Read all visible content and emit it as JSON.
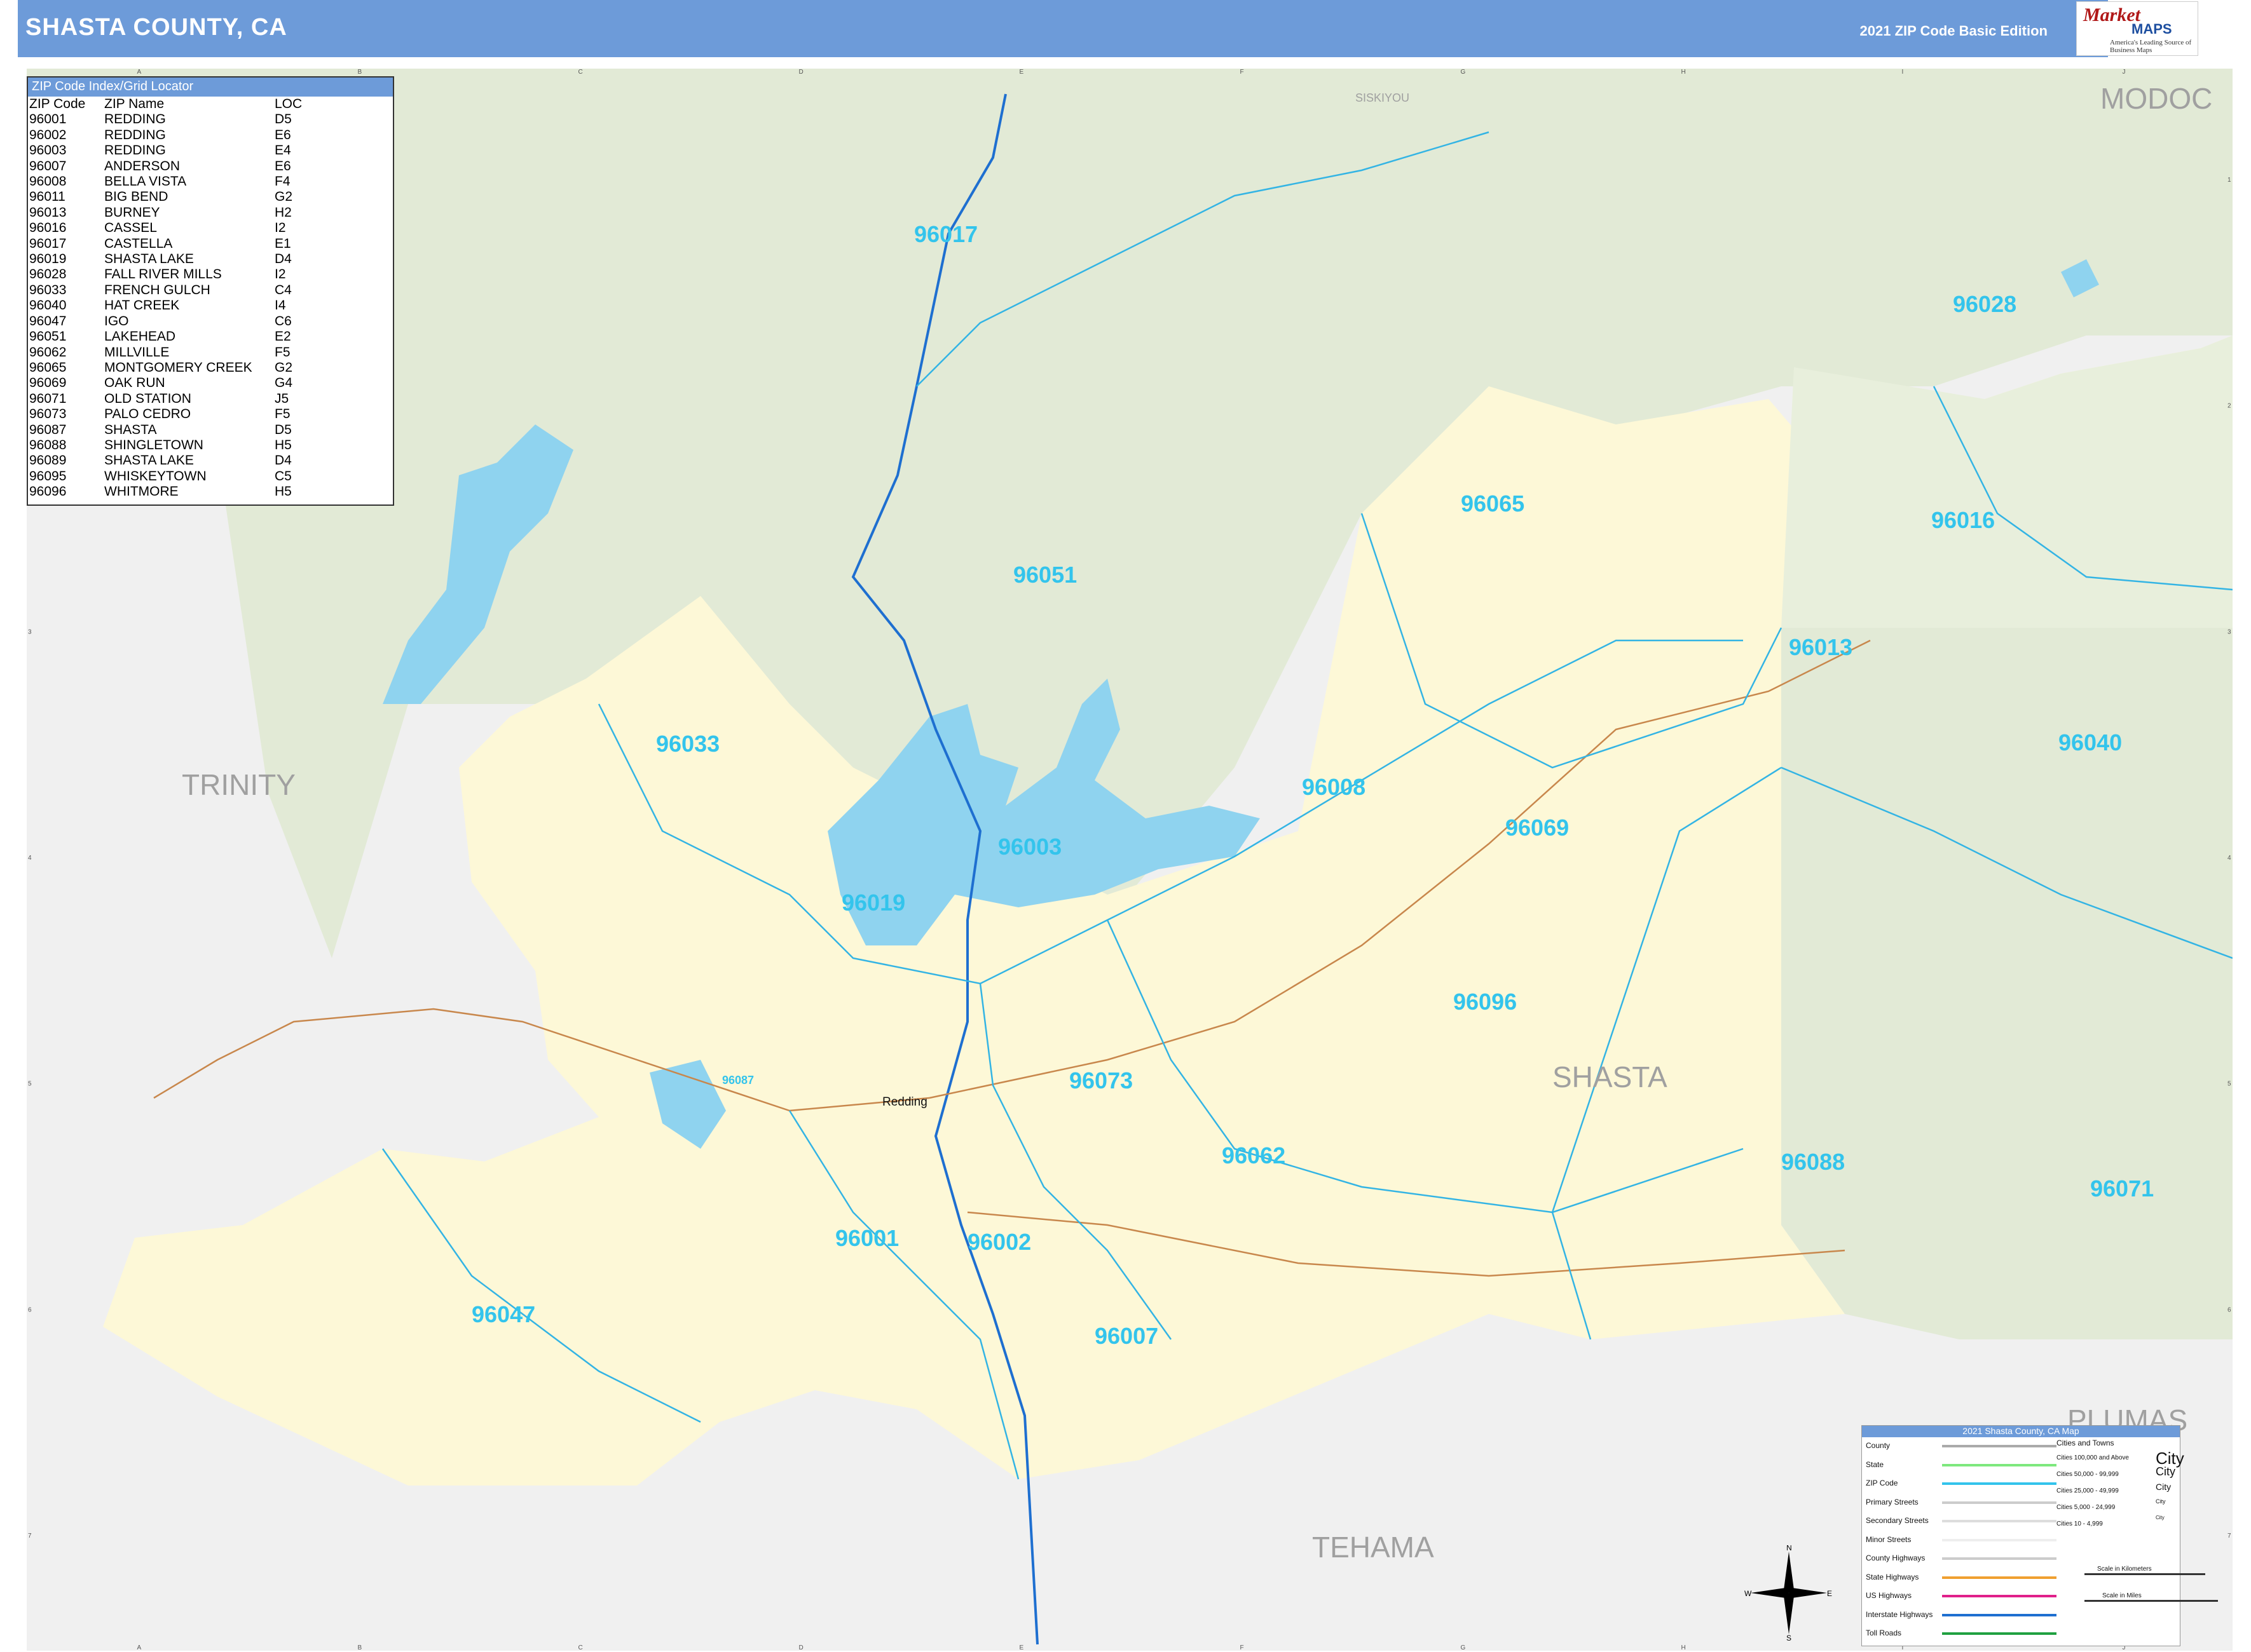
{
  "header": {
    "title": "SHASTA COUNTY, CA",
    "edition": "2021 ZIP Code Basic Edition",
    "logo": {
      "line1": "Market",
      "line2": "MAPS",
      "tagline": "America's Leading Source of Business Maps"
    }
  },
  "zip_index": {
    "title": "ZIP Code Index/Grid Locator",
    "columns": [
      "ZIP Code",
      "ZIP Name",
      "LOC"
    ],
    "rows": [
      [
        "96001",
        "REDDING",
        "D5"
      ],
      [
        "96002",
        "REDDING",
        "E6"
      ],
      [
        "96003",
        "REDDING",
        "E4"
      ],
      [
        "96007",
        "ANDERSON",
        "E6"
      ],
      [
        "96008",
        "BELLA VISTA",
        "F4"
      ],
      [
        "96011",
        "BIG BEND",
        "G2"
      ],
      [
        "96013",
        "BURNEY",
        "H2"
      ],
      [
        "96016",
        "CASSEL",
        "I2"
      ],
      [
        "96017",
        "CASTELLA",
        "E1"
      ],
      [
        "96019",
        "SHASTA LAKE",
        "D4"
      ],
      [
        "96028",
        "FALL RIVER MILLS",
        "I2"
      ],
      [
        "96033",
        "FRENCH GULCH",
        "C4"
      ],
      [
        "96040",
        "HAT CREEK",
        "I4"
      ],
      [
        "96047",
        "IGO",
        "C6"
      ],
      [
        "96051",
        "LAKEHEAD",
        "E2"
      ],
      [
        "96062",
        "MILLVILLE",
        "F5"
      ],
      [
        "96065",
        "MONTGOMERY CREEK",
        "G2"
      ],
      [
        "96069",
        "OAK RUN",
        "G4"
      ],
      [
        "96071",
        "OLD STATION",
        "J5"
      ],
      [
        "96073",
        "PALO CEDRO",
        "F5"
      ],
      [
        "96087",
        "SHASTA",
        "D5"
      ],
      [
        "96088",
        "SHINGLETOWN",
        "H5"
      ],
      [
        "96089",
        "SHASTA LAKE",
        "D4"
      ],
      [
        "96095",
        "WHISKEYTOWN",
        "C5"
      ],
      [
        "96096",
        "WHITMORE",
        "H5"
      ]
    ]
  },
  "map": {
    "counties": {
      "trinity": "TRINITY",
      "shasta": "SHASTA",
      "tehama": "TEHAMA",
      "modoc": "MODOC",
      "plumas": "PLUMAS",
      "siskiyou": "SISKIYOU"
    },
    "zips": {
      "z96017": "96017",
      "z96028": "96028",
      "z96065": "96065",
      "z96016": "96016",
      "z96051": "96051",
      "z96013": "96013",
      "z96033": "96033",
      "z96008": "96008",
      "z96069": "96069",
      "z96040": "96040",
      "z96003": "96003",
      "z96019": "96019",
      "z96096": "96096",
      "z96073": "96073",
      "z96087": "96087",
      "z96062": "96062",
      "z96088": "96088",
      "z96071": "96071",
      "z96001": "96001",
      "z96002": "96002",
      "z96047": "96047",
      "z96007": "96007"
    },
    "cities": {
      "redding": "Redding"
    },
    "grid_cols": [
      "A",
      "B",
      "C",
      "D",
      "E",
      "F",
      "G",
      "H",
      "I",
      "J"
    ],
    "grid_rows": [
      "1",
      "2",
      "3",
      "4",
      "5",
      "6",
      "7"
    ],
    "colors": {
      "shasta_fill": "#fdf8d7",
      "forest_fill": "#e2ead6",
      "outside_fill": "#f0f0f0",
      "water": "#8fd3ef",
      "zip_line": "#33b4e4",
      "road": "#c8874c",
      "interstate": "#1e6fd0"
    }
  },
  "legend": {
    "title": "2021 Shasta County, CA Map",
    "cities_title": "Cities and Towns",
    "items": [
      "County",
      "State",
      "ZIP Code",
      "Primary Streets",
      "Secondary Streets",
      "Minor Streets",
      "County Highways",
      "State Highways",
      "US Highways",
      "Interstate Highways",
      "Toll Roads"
    ],
    "city_sizes": [
      "Cities 100,000 and Above",
      "Cities 50,000 - 99,999",
      "Cities 25,000 - 49,999",
      "Cities 5,000 - 24,999",
      "Cities 10 - 4,999"
    ],
    "city_samples": [
      "City",
      "City",
      "City",
      "City",
      "City"
    ],
    "scale_km": "Scale in Kilometers",
    "scale_mi": "Scale in Miles"
  },
  "compass": {
    "n": "N",
    "s": "S",
    "e": "E",
    "w": "W"
  }
}
